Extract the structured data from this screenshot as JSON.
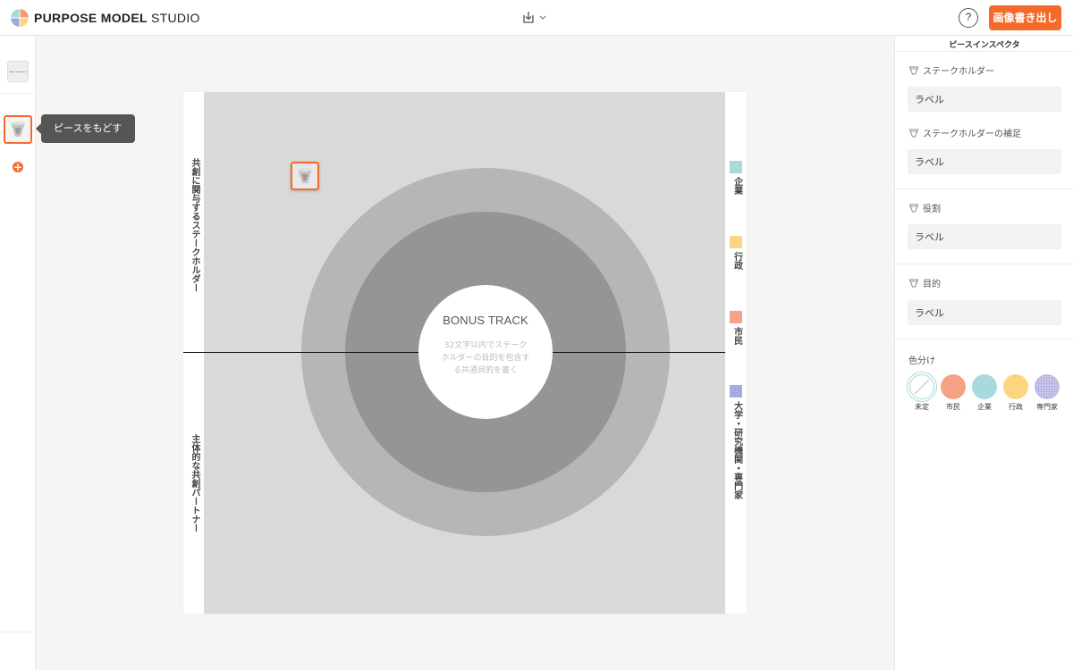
{
  "header": {
    "brand_bold": "PURPOSE MODEL",
    "brand_light": "STUDIO",
    "help_label": "?",
    "export_label": "画像書き出し"
  },
  "left_bar": {
    "add_label": "+"
  },
  "tooltip": {
    "text": "ピースをもどす"
  },
  "canvas": {
    "top_label": "共創に関与するステークホルダー",
    "bottom_label": "主体的な共創パートナー",
    "core_title": "BONUS TRACK",
    "core_desc": "32文字以内でステークホルダーの目的を包含する共通目的を書く",
    "legend": [
      {
        "label": "企業",
        "color": "#a8dadb"
      },
      {
        "label": "行政",
        "color": "#fbd580"
      },
      {
        "label": "市民",
        "color": "#f49a7b"
      },
      {
        "label": "大学・研究機関・専門家",
        "color": "#9ea8df"
      }
    ]
  },
  "inspector": {
    "title": "ピースインスペクタ",
    "fields": [
      {
        "label": "ステークホルダー",
        "value": "ラベル"
      },
      {
        "label": "ステークホルダーの補足",
        "value": "ラベル"
      },
      {
        "label": "役割",
        "value": "ラベル"
      },
      {
        "label": "目的",
        "value": "ラベル"
      }
    ],
    "color_section_label": "色分け",
    "color_options": [
      {
        "name": "未定",
        "color": "#ffffff"
      },
      {
        "name": "市民",
        "color": "#f49a7b"
      },
      {
        "name": "企業",
        "color": "#a8dadb"
      },
      {
        "name": "行政",
        "color": "#fbd580"
      },
      {
        "name": "専門家",
        "color": "#c8c6e9"
      }
    ]
  }
}
